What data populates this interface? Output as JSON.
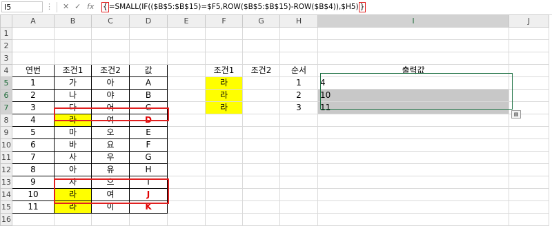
{
  "formula_bar": {
    "name_box": "I5",
    "cancel_icon": "✕",
    "enter_icon": "✓",
    "fx_label": "fx",
    "formula_open": "{",
    "formula_body": "=SMALL(IF(($B$5:$B$15)=$F5,ROW($B$5:$B$15)-ROW($B$4)),$H5)",
    "formula_close": "}"
  },
  "columns": [
    "A",
    "B",
    "C",
    "D",
    "E",
    "F",
    "G",
    "H",
    "I",
    "J"
  ],
  "row_numbers": [
    "1",
    "2",
    "3",
    "4",
    "5",
    "6",
    "7",
    "8",
    "9",
    "10",
    "11",
    "12",
    "13",
    "14",
    "15",
    "16"
  ],
  "left_table": {
    "headers": [
      "연번",
      "조건1",
      "조건2",
      "값"
    ],
    "rows": [
      [
        "1",
        "가",
        "아",
        "A"
      ],
      [
        "2",
        "나",
        "야",
        "B"
      ],
      [
        "3",
        "다",
        "어",
        "C"
      ],
      [
        "4",
        "라",
        "여",
        "D"
      ],
      [
        "5",
        "마",
        "오",
        "E"
      ],
      [
        "6",
        "바",
        "요",
        "F"
      ],
      [
        "7",
        "사",
        "우",
        "G"
      ],
      [
        "8",
        "아",
        "유",
        "H"
      ],
      [
        "9",
        "자",
        "으",
        "I"
      ],
      [
        "10",
        "라",
        "여",
        "J"
      ],
      [
        "11",
        "라",
        "이",
        "K"
      ]
    ]
  },
  "right_table": {
    "headers": {
      "F": "조건1",
      "G": "조건2",
      "H": "순서",
      "I": "출력값"
    },
    "rows": [
      {
        "F": "라",
        "H": "1",
        "I": "4"
      },
      {
        "F": "라",
        "H": "2",
        "I": "10"
      },
      {
        "F": "라",
        "H": "3",
        "I": "11"
      }
    ]
  },
  "colors": {
    "highlight": "#ffff00",
    "selection": "#217346",
    "annotation": "#e02020",
    "output_fill": "#c8c8c8"
  }
}
